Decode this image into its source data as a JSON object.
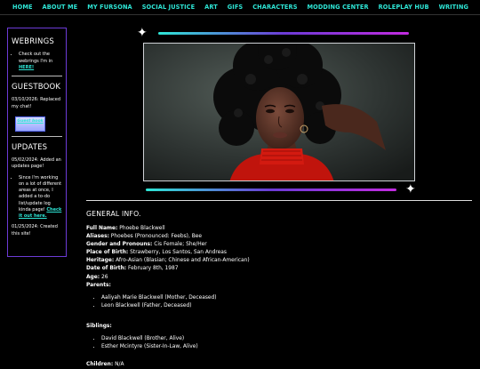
{
  "nav": {
    "items": [
      "HOME",
      "ABOUT ME",
      "MY FURSONA",
      "SOCIAL JUSTICE",
      "ART",
      "GIFS",
      "CHARACTERS",
      "MODDING CENTER",
      "ROLEPLAY HUB",
      "WRITING"
    ]
  },
  "sidebar": {
    "webrings": {
      "title": "WEBRINGS",
      "item_text": "Check out the webrings I'm in ",
      "item_link": "HERE!"
    },
    "guestbook": {
      "title": "GUESTBOOK",
      "entry": "03/10/2026: Replaced my chat!",
      "badge_text": "Guest book"
    },
    "updates": {
      "title": "UPDATES",
      "entry1": "05/02/2024: Added an updates page!",
      "entry2_text": "Since I'm working on a lot of different areas at once, I added a to-do list/update log kinda page! ",
      "entry2_link": "Check it out here.",
      "entry3": "01/25/2024: Created this site!"
    }
  },
  "main": {
    "section_title": "GENERAL INFO.",
    "fields": [
      {
        "label": "Full Name:",
        "value": " Phoebe Blackwell"
      },
      {
        "label": "Aliases:",
        "value": " Phoebes (Pronounced: Feebs), Bee"
      },
      {
        "label": "Gender and Pronouns:",
        "value": " Cis Female; She/Her"
      },
      {
        "label": "Place of Birth:",
        "value": " Strawberry, Los Santos, San Andreas"
      },
      {
        "label": "Heritage:",
        "value": " Afro-Asian (Blasian; Chinese and African-American)"
      },
      {
        "label": "Date of Birth:",
        "value": " February 8th, 1987"
      },
      {
        "label": "Age:",
        "value": " 26"
      },
      {
        "label": "Parents:",
        "value": ""
      }
    ],
    "parents": [
      "Aaliyah Marie Blackwell (Mother, Deceased)",
      "Leon Blackwell (Father, Deceased)"
    ],
    "siblings_label": "Siblings:",
    "siblings": [
      "David Blackwell (Brother, Alive)",
      "Esther Mcintyre (Sister-In-Law, Alive)"
    ],
    "children_label": "Children:",
    "children_value": " N/A"
  },
  "colors": {
    "accent": "#2ee6d6",
    "purple": "#6c3bd6",
    "magenta": "#c22be0"
  },
  "icons": [
    "sparkle-star-icon",
    "guestbook-badge"
  ]
}
